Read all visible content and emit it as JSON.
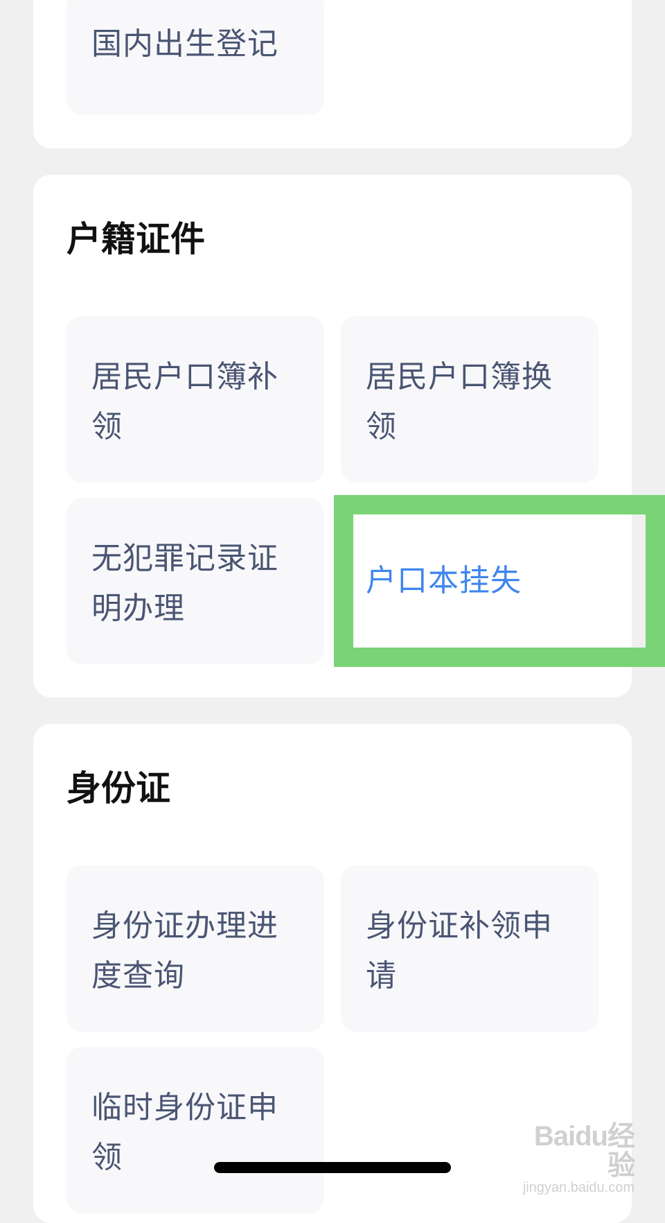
{
  "sections": {
    "birth": {
      "tiles": [
        {
          "label": "国内出生登记"
        }
      ]
    },
    "household": {
      "title": "户籍证件",
      "tiles": [
        {
          "label": "居民户口簿补领"
        },
        {
          "label": "居民户口簿换领"
        },
        {
          "label": "无犯罪记录证明办理"
        },
        {
          "label": "户口本挂失"
        }
      ],
      "highlighted_tile": "户口本挂失"
    },
    "id_card": {
      "title": "身份证",
      "tiles": [
        {
          "label": "身份证办理进度查询"
        },
        {
          "label": "身份证补领申请"
        },
        {
          "label": "临时身份证申领"
        }
      ]
    }
  },
  "colors": {
    "page_background": "#f0f0f0",
    "card_background": "#ffffff",
    "tile_background": "#f8f8fa",
    "tile_text": "#4a5573",
    "selected_text": "#3f86ee",
    "highlight_border": "#7ad374"
  },
  "watermark": {
    "logo": "Baidu经验",
    "url": "jingyan.baidu.com"
  }
}
